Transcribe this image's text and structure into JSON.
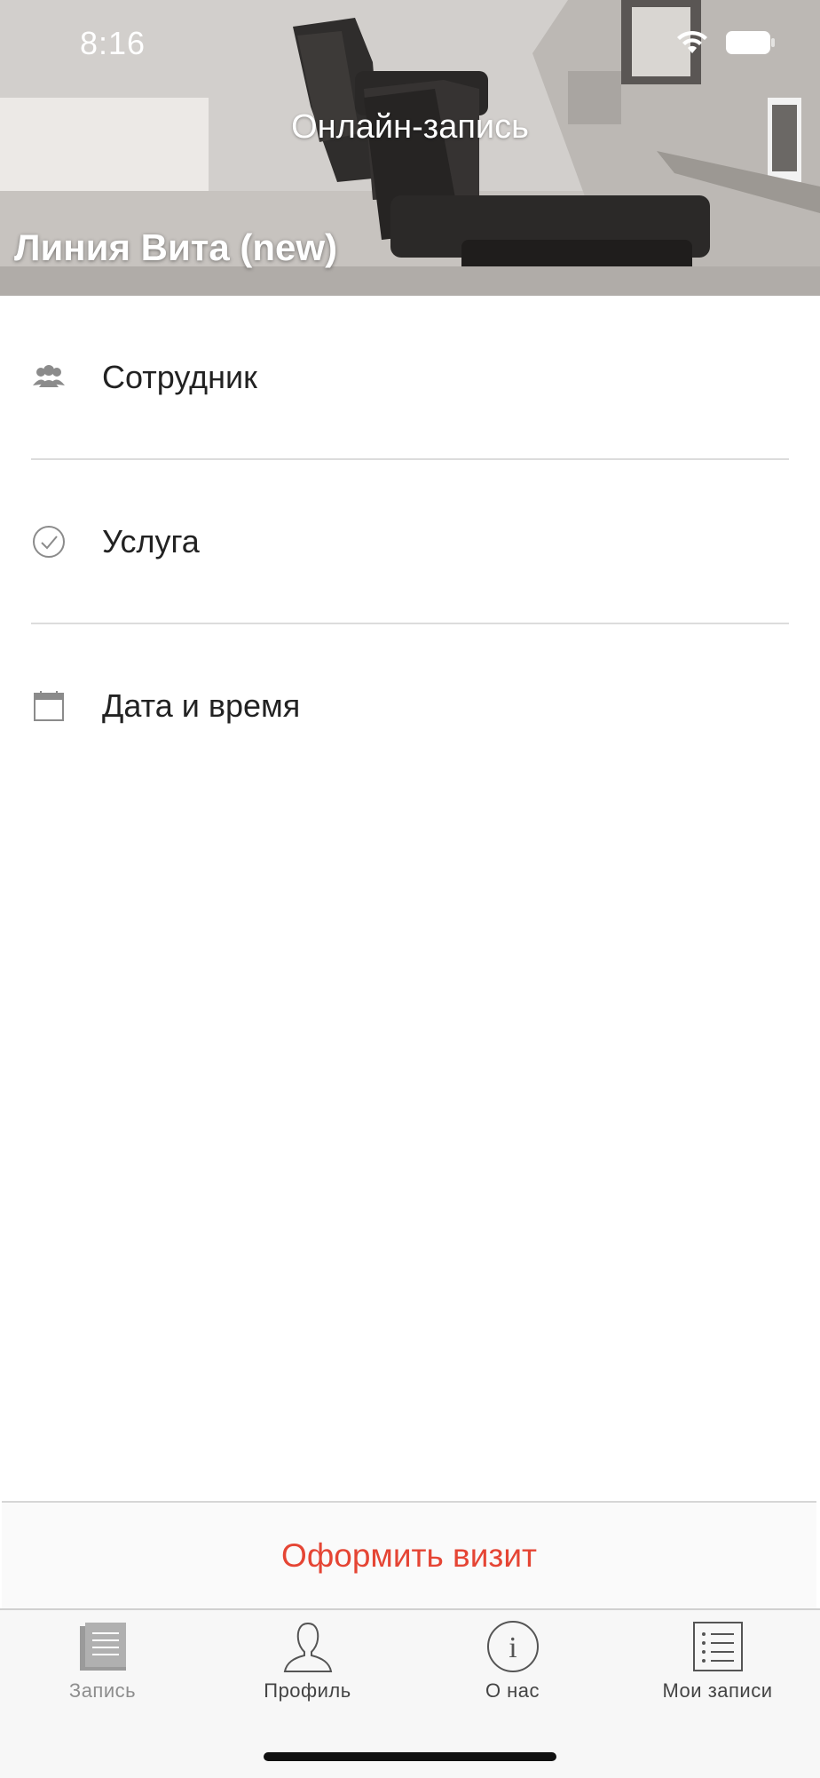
{
  "status_bar": {
    "time": "8:16"
  },
  "header": {
    "title": "Онлайн-запись",
    "salon_name": "Линия Вита (new)"
  },
  "booking": {
    "rows": [
      {
        "icon": "people-icon",
        "label": "Сотрудник"
      },
      {
        "icon": "checkmark-circle-icon",
        "label": "Услуга"
      },
      {
        "icon": "calendar-icon",
        "label": "Дата и время"
      }
    ]
  },
  "submit": {
    "label": "Оформить визит",
    "color": "#e54534"
  },
  "tab_bar": {
    "tabs": [
      {
        "icon": "booking-list-icon",
        "label": "Запись",
        "active": true
      },
      {
        "icon": "profile-icon",
        "label": "Профиль",
        "active": false
      },
      {
        "icon": "info-icon",
        "label": "О нас",
        "active": false
      },
      {
        "icon": "my-bookings-icon",
        "label": "Мои записи",
        "active": false
      }
    ]
  }
}
